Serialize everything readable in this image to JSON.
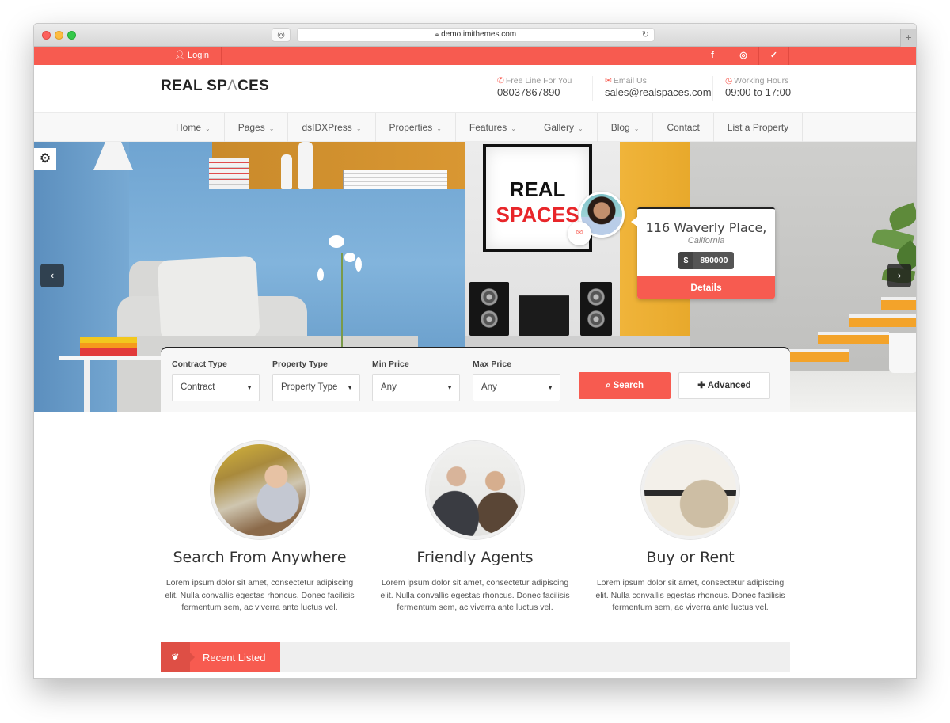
{
  "browser": {
    "url": "demo.imithemes.com",
    "new_tab_label": "+"
  },
  "topbar": {
    "login_label": "Login",
    "socials": [
      {
        "icon": "facebook-icon",
        "glyph": "f"
      },
      {
        "icon": "instagram-icon",
        "glyph": "◎"
      },
      {
        "icon": "twitter-icon",
        "glyph": "🐦︎"
      }
    ]
  },
  "header": {
    "logo_part1": "REAL SP",
    "logo_accent": "Λ",
    "logo_part2": "CES",
    "contacts": [
      {
        "icon": "phone-icon",
        "label": "Free Line For You",
        "value": "08037867890"
      },
      {
        "icon": "envelope-icon",
        "label": "Email Us",
        "value": "sales@realspaces.com"
      },
      {
        "icon": "clock-icon",
        "label": "Working Hours",
        "value": "09:00 to 17:00"
      }
    ]
  },
  "nav": {
    "items": [
      {
        "label": "Home",
        "dropdown": true
      },
      {
        "label": "Pages",
        "dropdown": true
      },
      {
        "label": "dsIDXPress",
        "dropdown": true
      },
      {
        "label": "Properties",
        "dropdown": true
      },
      {
        "label": "Features",
        "dropdown": true
      },
      {
        "label": "Gallery",
        "dropdown": true
      },
      {
        "label": "Blog",
        "dropdown": true
      },
      {
        "label": "Contact",
        "dropdown": false
      },
      {
        "label": "List a Property",
        "dropdown": false
      }
    ]
  },
  "hero": {
    "frame_line1": "REAL",
    "frame_line2": "SPACES",
    "property": {
      "title": "116 Waverly Place,",
      "location": "California",
      "currency": "$",
      "price": "890000",
      "details_label": "Details"
    }
  },
  "search": {
    "fields": [
      {
        "label": "Contract Type",
        "value": "Contract"
      },
      {
        "label": "Property Type",
        "value": "Property Type"
      },
      {
        "label": "Min Price",
        "value": "Any"
      },
      {
        "label": "Max Price",
        "value": "Any"
      }
    ],
    "search_label": "Search",
    "advanced_label": "Advanced"
  },
  "features": [
    {
      "title": "Search From Anywhere",
      "text": "Lorem ipsum dolor sit amet, consectetur adipiscing elit. Nulla convallis egestas rhoncus. Donec facilisis fermentum sem, ac viverra ante luctus vel."
    },
    {
      "title": "Friendly Agents",
      "text": "Lorem ipsum dolor sit amet, consectetur adipiscing elit. Nulla convallis egestas rhoncus. Donec facilisis fermentum sem, ac viverra ante luctus vel."
    },
    {
      "title": "Buy or Rent",
      "text": "Lorem ipsum dolor sit amet, consectetur adipiscing elit. Nulla convallis egestas rhoncus. Donec facilisis fermentum sem, ac viverra ante luctus vel."
    }
  ],
  "recent": {
    "label": "Recent Listed"
  },
  "colors": {
    "accent": "#f75b50",
    "dark": "#222222"
  }
}
